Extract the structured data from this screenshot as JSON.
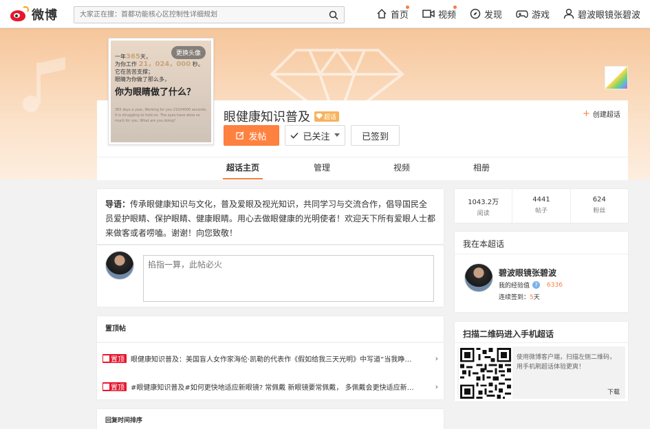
{
  "topbar": {
    "logo_text": "微博",
    "search_placeholder": "大家正在搜：首都功能核心区控制性详细规划",
    "nav": [
      {
        "label": "首页",
        "icon": "home-icon",
        "dot": true
      },
      {
        "label": "视频",
        "icon": "video-icon",
        "dot": true
      },
      {
        "label": "发现",
        "icon": "compass-icon",
        "dot": false
      },
      {
        "label": "游戏",
        "icon": "gamepad-icon",
        "dot": false
      },
      {
        "label": "碧波眼镜张碧波",
        "icon": "user-icon",
        "dot": false
      }
    ]
  },
  "cover": {
    "change_avatar": "更换头像",
    "line1_a": "一年",
    "line1_b": "365",
    "line1_c": "天，",
    "line2_a": "为你工作",
    "line2_b": "21，024，000",
    "line2_c": "秒。",
    "line3": "它在苦苦支撑；",
    "line4": "眼睛为你做了那么多，",
    "headline": "你为眼睛做了什么？",
    "english": "365 days a year, Working for you 21024000 seconds. It is struggling to hold on. The eyes have done so much for you. What are you doing?"
  },
  "header": {
    "title": "眼健康知识普及",
    "badge": "超话",
    "post_label": "发帖",
    "follow_label": "已关注",
    "sign_label": "已签到",
    "create_label": "创建超话"
  },
  "tabs": [
    "超话主页",
    "管理",
    "视频",
    "相册"
  ],
  "intro": {
    "prefix": "导语：",
    "text": "传承眼健康知识与文化，普及爱眼及视光知识，共同学习与交流合作，倡导国民全员爱护眼睛、保护眼睛、健康眼睛。用心去做眼健康的光明使者！欢迎天下所有爱眼人士都来做客或者唠嗑。谢谢！向您致敬！"
  },
  "compose": {
    "placeholder": "掐指一算，此帖必火"
  },
  "pinned": {
    "title": "置顶帖",
    "tag": "置顶",
    "rows": [
      "眼健康知识普及：美国盲人女作家海伦·凯勒的代表作《假如给我三天光明》中写道“当我睁…",
      "#眼健康知识普及#如何更快地适应新眼镜? 常佩戴 新眼镜要常佩戴， 多佩戴会更快适应新…"
    ]
  },
  "reply": {
    "title": "回复时间排序"
  },
  "stats": [
    {
      "value": "1043.2万",
      "label": "阅读"
    },
    {
      "value": "4441",
      "label": "帖子"
    },
    {
      "value": "624",
      "label": "粉丝"
    }
  ],
  "me": {
    "title": "我在本超话",
    "name": "碧波眼镜张碧波",
    "exp_label": "我的经验值",
    "exp_value": "6336",
    "sign_label": "连续签到：",
    "sign_value": "5",
    "sign_unit": "天"
  },
  "qr": {
    "title": "扫描二维码进入手机超话",
    "desc": "使用微博客户端，扫描左侧二维码，用手机刷超话体验更爽！",
    "download": "下载"
  },
  "colors": {
    "accent": "#ff8140",
    "brand_red": "#e6162d",
    "banner": "#f6c69b"
  }
}
